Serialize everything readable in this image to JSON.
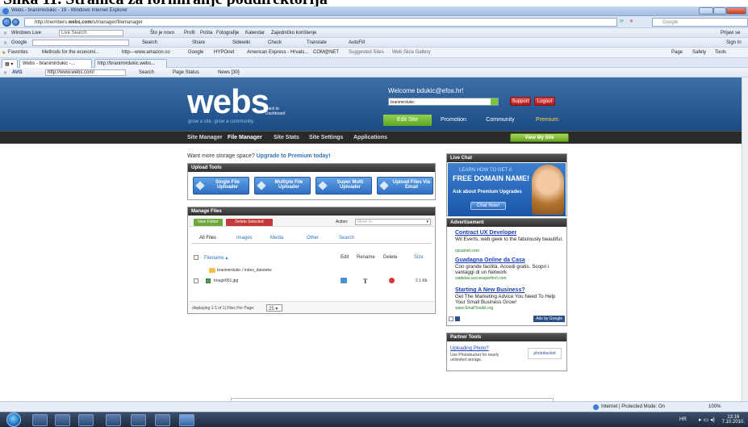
{
  "caption": "Slika 11. Stranica za formiranje poddirektorija",
  "window": {
    "title": "Webs - branimirdukic - 19 - Windows Internet Explorer"
  },
  "address": {
    "url_prefix": "http://members.",
    "url_bold": "webs.com",
    "url_suffix": "/s/manager/filemanager",
    "search_placeholder": "Google"
  },
  "toolbar1": {
    "items": [
      "Windows Live",
      "Live Search",
      "Što je novo",
      "Profil",
      "Pošta",
      "Fotografije",
      "Kalendar",
      "Zajedničko korištenje"
    ],
    "right": "Prijavi se"
  },
  "toolbar2": {
    "items": [
      "Google",
      "Search",
      "Share",
      "Sidewiki",
      "Check",
      "Translate",
      "AutoFill"
    ],
    "right": "Sign In"
  },
  "favorites": {
    "items": [
      "Favorites",
      "Methods for the economi...",
      "http---www.amazon.co",
      "Google",
      "HYPOnet",
      "American Express - Hrvats...",
      "COM@NET",
      "Suggested Sites",
      "Web Slice Gallery"
    ],
    "right": [
      "Page",
      "Safety",
      "Tools"
    ]
  },
  "tabs": [
    "Webs - branimirdukic -...",
    "http://branimirdukic.webs..."
  ],
  "avgbar": {
    "items": [
      "AVG",
      "http://www.webs.com/",
      "Search",
      "Page Status",
      "News [30]"
    ]
  },
  "webs": {
    "logo": "webs",
    "back": "Back to Dashboard",
    "tagline": "grow a site. grow a community.",
    "welcome": "Welcome bdukic@efos.hr!",
    "site_select": "branimirdukic",
    "support": "Support",
    "logout": "Logout",
    "header_tabs": [
      "Edit Site",
      "Promotion",
      "Community",
      "Premium"
    ],
    "nav": [
      "Site Manager",
      "File Manager",
      "Site Stats",
      "Site Settings",
      "Applications"
    ],
    "view_site": "View My Site",
    "storage_text": "Want more storage space?",
    "storage_link": "Upgrade to Premium today!"
  },
  "upload_tools": {
    "title": "Upload Tools",
    "buttons": [
      "Single File Uploader",
      "Multiple File Uploader",
      "Super Multi Uploader",
      "Upload Files Via Email"
    ]
  },
  "manage_files": {
    "title": "Manage Files",
    "new_folder": "New Folder",
    "delete_selected": "Delete Selected",
    "action_label": "Action:",
    "action_placeholder": "Move to",
    "tabs": [
      "All Files",
      "Images",
      "Media",
      "Other",
      "Search"
    ],
    "columns": [
      "Filename",
      "Edit",
      "Rename",
      "Delete",
      "Size"
    ],
    "path": "branimirdukic / index_datoteke",
    "files": [
      {
        "name": "Image001.jpg",
        "size": "2.1 Kb"
      }
    ],
    "footer": "displaying 1-1 of 1| Files Per Page:",
    "per_page": "25"
  },
  "live_chat": {
    "title": "Live Chat",
    "line1": "LEARN HOW TO GET A",
    "line2": "FREE DOMAIN NAME!",
    "line3": "Ask about Premium Upgrades",
    "button": "Chat Now!"
  },
  "advertisement": {
    "title": "Advertisement",
    "ads": [
      {
        "title": "Contract UX Developer",
        "text": "Wil Everts, web geek to the fabulously beautiful.",
        "url": "cpuainet.com"
      },
      {
        "title": "Guadagna Online da Casa",
        "text": "Con grande facilità. Accedi gratis. Scopri i vantaggi di un Network",
        "url": "viadelav.successperfect.com"
      },
      {
        "title": "Starting A New Business?",
        "text": "Get The Marketing Advice You Need To Help Your Small Business Grow!",
        "url": "www.SmallToolkit.org"
      }
    ],
    "ads_by": "Ads by Google"
  },
  "partner_tools": {
    "title": "Partner Tools",
    "link": "Uploading Photo?",
    "text": "Use Photobucket for nearly unlimited storage.",
    "logo": "photobucket"
  },
  "statusbar": {
    "zone": "Internet | Protected Mode: On",
    "zoom": "100%"
  },
  "taskbar": {
    "lang": "HR",
    "time": "13:16",
    "date": "7.10.2010."
  }
}
